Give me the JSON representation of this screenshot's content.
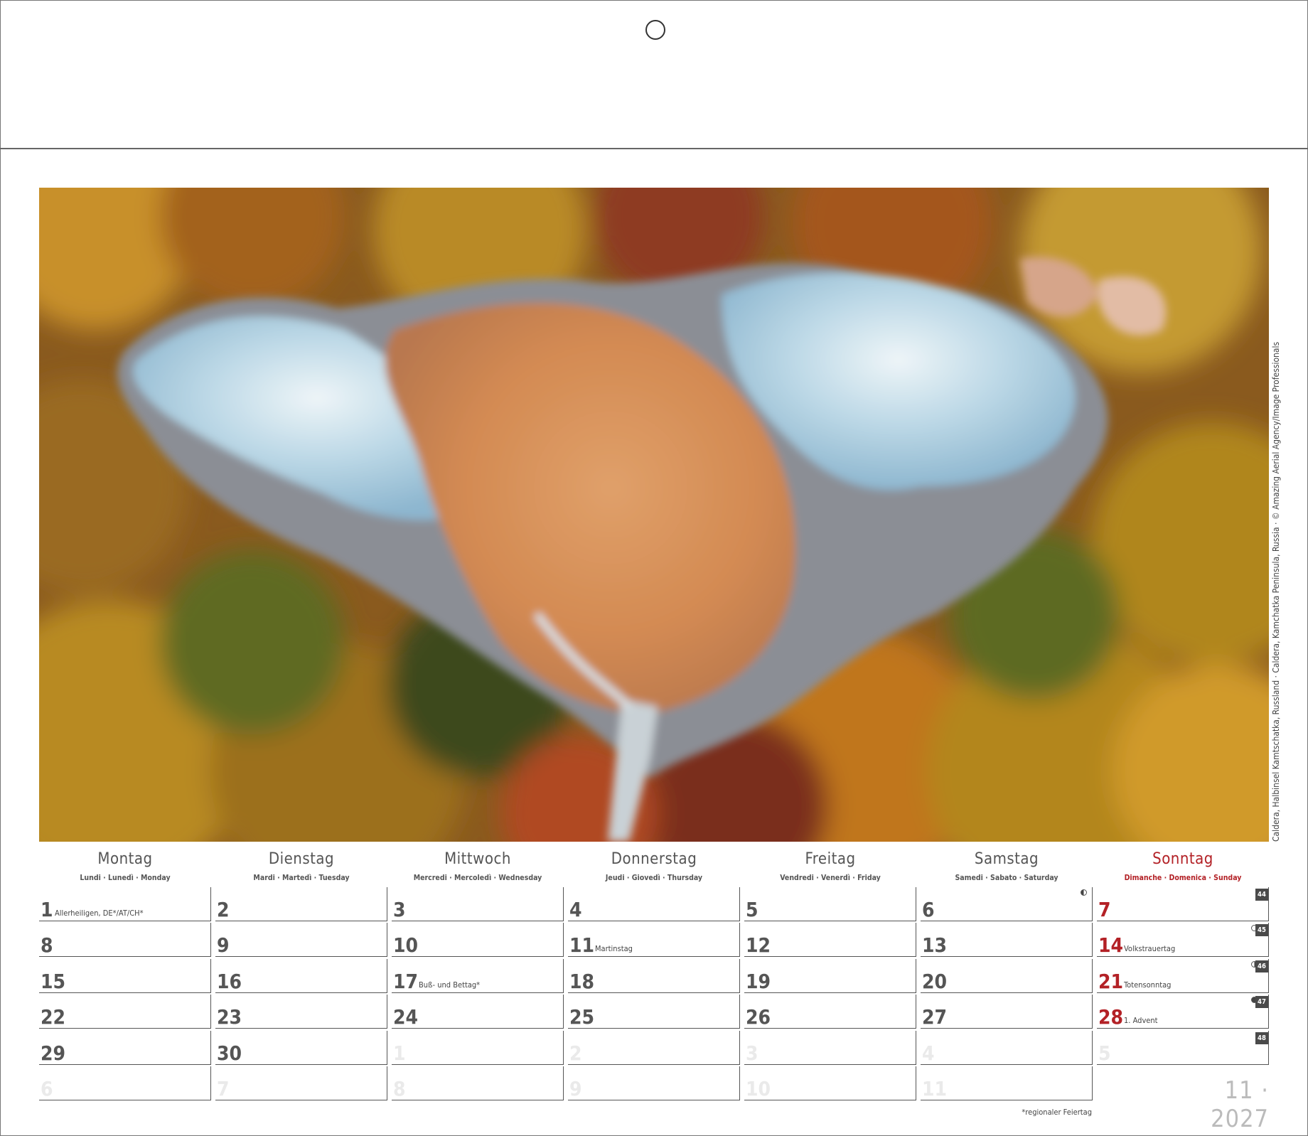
{
  "photo": {
    "caption": "Caldera, Halbinsel Kamtschatka, Russland · Caldera, Kamchatka Peninsula, Russia · © Amazing Aerial Agency/Image Professionals"
  },
  "weekdays": [
    {
      "de": "Montag",
      "alt": "Lundi · Lunedì · Monday"
    },
    {
      "de": "Dienstag",
      "alt": "Mardi · Martedì · Tuesday"
    },
    {
      "de": "Mittwoch",
      "alt": "Mercredi · Mercoledì · Wednesday"
    },
    {
      "de": "Donnerstag",
      "alt": "Jeudi · Giovedì · Thursday"
    },
    {
      "de": "Freitag",
      "alt": "Vendredi · Venerdì · Friday"
    },
    {
      "de": "Samstag",
      "alt": "Samedi · Sabato · Saturday"
    },
    {
      "de": "Sonntag",
      "alt": "Dimanche · Domenica · Sunday"
    }
  ],
  "weeks": [
    {
      "kw": "44",
      "days": [
        {
          "n": "1",
          "note": "Allerheiligen, DE*/AT/CH*"
        },
        {
          "n": "2"
        },
        {
          "n": "3"
        },
        {
          "n": "4"
        },
        {
          "n": "5"
        },
        {
          "n": "6",
          "moon": "half-l"
        },
        {
          "n": "7",
          "red": true
        }
      ]
    },
    {
      "kw": "45",
      "days": [
        {
          "n": "8"
        },
        {
          "n": "9"
        },
        {
          "n": "10"
        },
        {
          "n": "11",
          "note": "Martinstag"
        },
        {
          "n": "12"
        },
        {
          "n": "13"
        },
        {
          "n": "14",
          "red": true,
          "note": "Volkstrauertag",
          "moon": "full"
        }
      ]
    },
    {
      "kw": "46",
      "days": [
        {
          "n": "15"
        },
        {
          "n": "16"
        },
        {
          "n": "17",
          "note": "Buß- und Bettag*"
        },
        {
          "n": "18"
        },
        {
          "n": "19"
        },
        {
          "n": "20"
        },
        {
          "n": "21",
          "red": true,
          "note": "Totensonntag",
          "moon": "half-r"
        }
      ]
    },
    {
      "kw": "47",
      "days": [
        {
          "n": "22"
        },
        {
          "n": "23"
        },
        {
          "n": "24"
        },
        {
          "n": "25"
        },
        {
          "n": "26"
        },
        {
          "n": "27"
        },
        {
          "n": "28",
          "red": true,
          "note": "1. Advent",
          "moon": "new"
        }
      ]
    },
    {
      "kw": "48",
      "days": [
        {
          "n": "29"
        },
        {
          "n": "30"
        },
        {
          "n": "1",
          "ghost": true
        },
        {
          "n": "2",
          "ghost": true
        },
        {
          "n": "3",
          "ghost": true
        },
        {
          "n": "4",
          "ghost": true
        },
        {
          "n": "5",
          "ghost": true
        }
      ]
    },
    {
      "kw": "",
      "days": [
        {
          "n": "6",
          "ghost": true
        },
        {
          "n": "7",
          "ghost": true
        },
        {
          "n": "8",
          "ghost": true
        },
        {
          "n": "9",
          "ghost": true
        },
        {
          "n": "10",
          "ghost": true
        },
        {
          "n": "11",
          "ghost": true
        }
      ]
    }
  ],
  "month_year": "11 · 2027",
  "footnote": "*regionaler Feiertag"
}
